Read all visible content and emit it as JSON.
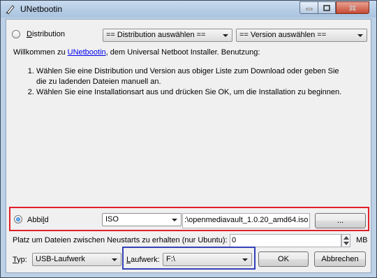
{
  "window": {
    "title": "UNetbootin"
  },
  "distribution": {
    "label_first": "D",
    "label_rest": "istribution",
    "distro_select": "== Distribution auswählen ==",
    "version_select": "== Version auswählen =="
  },
  "intro": {
    "prefix": "Willkommen zu ",
    "link": "UNetbootin",
    "suffix": ", dem Universal Netboot Installer. Benutzung:",
    "steps": [
      "Wählen Sie eine Distribution und Version aus obiger Liste zum Download oder geben Sie die zu ladenden Dateien manuell an.",
      "Wählen Sie eine Installationsart aus und drücken Sie OK, um die Installation zu beginnen."
    ]
  },
  "diskimage": {
    "label_pre": "Abbi",
    "label_under": "l",
    "label_post": "d",
    "type_select": "ISO",
    "path_value": ":\\openmediavault_1.0.20_amd64.iso",
    "browse_label": "..."
  },
  "persistence": {
    "label": "Platz um Dateien zwischen Neustarts zu erhalten (nur Ubuntu):",
    "value": "0",
    "unit": "MB"
  },
  "bottom": {
    "type_label_first": "T",
    "type_label_rest": "yp:",
    "type_select": "USB-Laufwerk",
    "drive_label_first": "L",
    "drive_label_rest": "aufwerk:",
    "drive_select": "F:\\",
    "ok_label": "OK",
    "cancel_label": "Abbrechen"
  },
  "highlight_colors": {
    "red_box": "#e0202a",
    "blue_box": "#3340b8"
  }
}
